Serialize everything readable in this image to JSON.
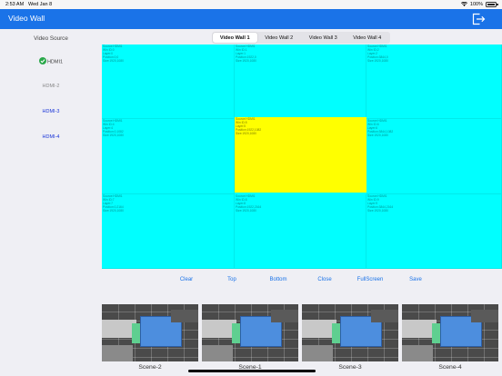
{
  "status_bar": {
    "time": "2:53 AM",
    "date": "Wed Jan 8",
    "battery": "100%",
    "battery_level": 1.0,
    "wifi_icon": "wifi-icon"
  },
  "nav": {
    "title": "Video Wall",
    "logout_icon": "logout-icon",
    "accent_color": "#1a73e8"
  },
  "sidebar": {
    "title": "Video Source",
    "items": [
      {
        "label": "HDMI1",
        "selected": true,
        "color": "#444444"
      },
      {
        "label": "HDMI-2",
        "selected": false,
        "color": "#888888"
      },
      {
        "label": "HDMI-3",
        "selected": false,
        "color": "#1a35d8"
      },
      {
        "label": "HDMI-4",
        "selected": false,
        "color": "#1a35d8"
      }
    ]
  },
  "tabs": [
    {
      "label": "Video Wall 1",
      "active": true
    },
    {
      "label": "Video Wall 2",
      "active": false
    },
    {
      "label": "Video Wall 3",
      "active": false
    },
    {
      "label": "Video Wall 4",
      "active": false
    }
  ],
  "wall": {
    "colors": {
      "normal": "#00ffff",
      "selected": "#ffff00"
    },
    "cells": [
      {
        "row": 0,
        "col": 0,
        "lines": [
          "Source:HDMI1",
          "Win ID:0",
          "Layer:0",
          "Position:0,0",
          "Size:1920,1080"
        ]
      },
      {
        "row": 0,
        "col": 1,
        "lines": [
          "Source:HDMI1",
          "Win ID:1",
          "Layer:1",
          "Position:1922,0",
          "Size:1920,1080"
        ]
      },
      {
        "row": 0,
        "col": 2,
        "lines": [
          "Source:HDMI1",
          "Win ID:2",
          "Layer:2",
          "Position:3844,0",
          "Size:1920,1080"
        ]
      },
      {
        "row": 1,
        "col": 0,
        "lines": [
          "Source:HDMI1",
          "Win ID:4",
          "Layer:4",
          "Position:0,1082",
          "Size:1920,1080"
        ]
      },
      {
        "row": 1,
        "col": 1,
        "lines": [
          "Source:HDMI1",
          "Win ID:5",
          "Layer:5",
          "Position:1922,1082",
          "Size:1920,1080"
        ],
        "selected": true
      },
      {
        "row": 1,
        "col": 2,
        "lines": [
          "Source:HDMI1",
          "Win ID:6",
          "Layer:6",
          "Position:3844,1082",
          "Size:1920,1080"
        ]
      },
      {
        "row": 2,
        "col": 0,
        "lines": [
          "Source:HDMI1",
          "Win ID:7",
          "Layer:7",
          "Position:0,2164",
          "Size:1920,1080"
        ]
      },
      {
        "row": 2,
        "col": 1,
        "lines": [
          "Source:HDMI1",
          "Win ID:8",
          "Layer:8",
          "Position:1922,2164",
          "Size:1920,1080"
        ]
      },
      {
        "row": 2,
        "col": 2,
        "lines": [
          "Source:HDMI1",
          "Win ID:9",
          "Layer:9",
          "Position:3844,2164",
          "Size:1920,1080"
        ]
      }
    ]
  },
  "actions": [
    "Clear",
    "Top",
    "Bottom",
    "Close",
    "FullScreen",
    "Save"
  ],
  "scenes": [
    {
      "label": "Scene-2"
    },
    {
      "label": "Scene-1"
    },
    {
      "label": "Scene-3"
    },
    {
      "label": "Scene-4"
    }
  ]
}
